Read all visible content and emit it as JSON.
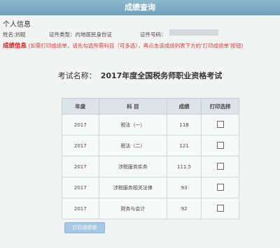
{
  "header": {
    "title": "成绩查询"
  },
  "personal": {
    "heading": "个人信息",
    "name_label": "姓名:刘砚",
    "id_type_label": "证件类型：内地居民身份证",
    "id_number_label": "证件号码："
  },
  "notice": {
    "label": "成绩信息",
    "hint": "(如需打印成绩单，请先勾选所需科目（可多选），再点击该成绩列表下方的‘打印成绩单’按钮)"
  },
  "exam": {
    "label": "考试名称：",
    "name": "2017年度全国税务师职业资格考试"
  },
  "table": {
    "headers": [
      "年度",
      "科 目",
      "成绩",
      "打印选择"
    ],
    "rows": [
      {
        "year": "2017",
        "subject": "税法（一）",
        "score": "118"
      },
      {
        "year": "2017",
        "subject": "税法（二）",
        "score": "121"
      },
      {
        "year": "2017",
        "subject": "涉税服务实务",
        "score": "111.5"
      },
      {
        "year": "2017",
        "subject": "涉税服务相关法律",
        "score": "93"
      },
      {
        "year": "2017",
        "subject": "财务与会计",
        "score": "92"
      }
    ]
  },
  "print_button": "打印成绩单"
}
